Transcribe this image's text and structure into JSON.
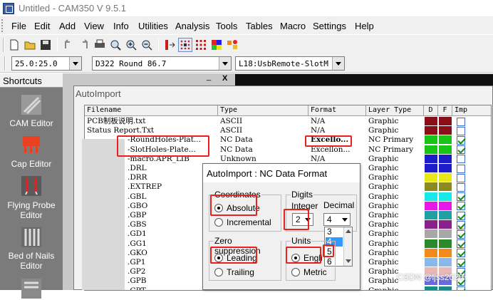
{
  "window": {
    "title": "Untitled - CAM350 V 9.5.1"
  },
  "menu": [
    "File",
    "Edit",
    "Add",
    "View",
    "Info",
    "Utilities",
    "Analysis",
    "Tools",
    "Tables",
    "Macro",
    "Settings",
    "Help"
  ],
  "toolbar2": {
    "zoom_value": "25.0:25.0",
    "dcode_value": "D322  Round 86.7",
    "layer_value": "L18:UsbRemote-SlotM"
  },
  "shortcuts": {
    "header": "Shortcuts",
    "items": [
      "CAM Editor",
      "Cap Editor",
      "Flying Probe Editor",
      "Bed of Nails Editor"
    ]
  },
  "editor": {
    "min_label": "_",
    "close_label": "X"
  },
  "autoimport": {
    "title": "AutoImport",
    "columns": [
      "Filename",
      "Type",
      "Format",
      "Layer Type",
      "D",
      "F",
      "Imp"
    ],
    "rows": [
      {
        "filename": "PCB制板说明.txt",
        "type": "ASCII",
        "format": "N/A",
        "layer": "Graphic",
        "d": "#8b0f18",
        "f": "#8b0f18",
        "imp": false
      },
      {
        "filename": "Status Report.Txt",
        "type": "ASCII",
        "format": "N/A",
        "layer": "Graphic",
        "d": "#8b0f18",
        "f": "#8b0f18",
        "imp": false
      },
      {
        "filename": "-RoundHoles-Plat...",
        "type": "NC Data",
        "format": "Excello...",
        "layer": "NC Primary",
        "d": "#17c417",
        "f": "#17c417",
        "imp": true
      },
      {
        "filename": "-SlotHoles-Plate...",
        "type": "NC Data",
        "format": "Excellon...",
        "layer": "NC Primary",
        "d": "#17c417",
        "f": "#17c417",
        "imp": true
      },
      {
        "filename": "-macro.APR_LIB",
        "type": "Unknown",
        "format": "N/A",
        "layer": "Graphic",
        "d": "#1c1cc8",
        "f": "#1c1cc8",
        "imp": false
      },
      {
        "filename": ".DRL",
        "type": "",
        "format": "",
        "layer": "Graphic",
        "d": "#1c1cc8",
        "f": "#1c1cc8",
        "imp": false
      },
      {
        "filename": ".DRR",
        "type": "",
        "format": "",
        "layer": "Graphic",
        "d": "#e8e818",
        "f": "#e8e818",
        "imp": false
      },
      {
        "filename": ".EXTREP",
        "type": "",
        "format": "",
        "layer": "Graphic",
        "d": "#8a8a20",
        "f": "#8a8a20",
        "imp": false
      },
      {
        "filename": ".GBL",
        "type": "",
        "format": "",
        "layer": "Graphic",
        "d": "#18e8e8",
        "f": "#18e8e8",
        "imp": true
      },
      {
        "filename": ".GBO",
        "type": "",
        "format": "",
        "layer": "Graphic",
        "d": "#e818e8",
        "f": "#e818e8",
        "imp": true
      },
      {
        "filename": ".GBP",
        "type": "",
        "format": "",
        "layer": "Graphic",
        "d": "#20a0a0",
        "f": "#20a0a0",
        "imp": true
      },
      {
        "filename": ".GBS",
        "type": "",
        "format": "",
        "layer": "Graphic",
        "d": "#8a208a",
        "f": "#8a208a",
        "imp": true
      },
      {
        "filename": ".GD1",
        "type": "",
        "format": "",
        "layer": "Graphic",
        "d": "#a8a8a8",
        "f": "#a8a8a8",
        "imp": true
      },
      {
        "filename": ".GG1",
        "type": "",
        "format": "",
        "layer": "Graphic",
        "d": "#2a8a2a",
        "f": "#2a8a2a",
        "imp": true
      },
      {
        "filename": ".GKO",
        "type": "",
        "format": "",
        "layer": "Graphic",
        "d": "#f08a18",
        "f": "#f08a18",
        "imp": true
      },
      {
        "filename": ".GP1",
        "type": "",
        "format": "",
        "layer": "Graphic",
        "d": "#8ab8e8",
        "f": "#8ab8e8",
        "imp": true
      },
      {
        "filename": ".GP2",
        "type": "",
        "format": "",
        "layer": "Graphic",
        "d": "#e8b8b8",
        "f": "#e8b8b8",
        "imp": true
      },
      {
        "filename": ".GPB",
        "type": "",
        "format": "",
        "layer": "Graphic",
        "d": "#6868e8",
        "f": "#6868e8",
        "imp": true
      },
      {
        "filename": ".GPT",
        "type": "",
        "format": "",
        "layer": "Graphic",
        "d": "#188a8a",
        "f": "#188a8a",
        "imp": true
      }
    ]
  },
  "nc_dialog": {
    "title": "AutoImport : NC Data Format",
    "coordinates": {
      "label": "Coordinates",
      "absolute": "Absolute",
      "incremental": "Incremental",
      "selected": "Absolute"
    },
    "digits": {
      "label": "Digits",
      "integer_label": "Integer",
      "integer_value": "2",
      "decimal_label": "Decimal",
      "decimal_value": "4",
      "decimal_options": [
        "3",
        "4",
        "5",
        "6"
      ],
      "highlighted": "4"
    },
    "zero_suppression": {
      "label": "Zero suppression",
      "leading": "Leading",
      "trailing": "Trailing",
      "selected": "Leading"
    },
    "units": {
      "label": "Units",
      "english": "Engli",
      "metric": "Metric",
      "selected": "English"
    }
  },
  "watermark": "CSDN @ljss2020",
  "colors": {
    "highlight_red": "#e8201e",
    "list_select": "#3399ff",
    "shortcut_bg": "#7b7b7b"
  }
}
